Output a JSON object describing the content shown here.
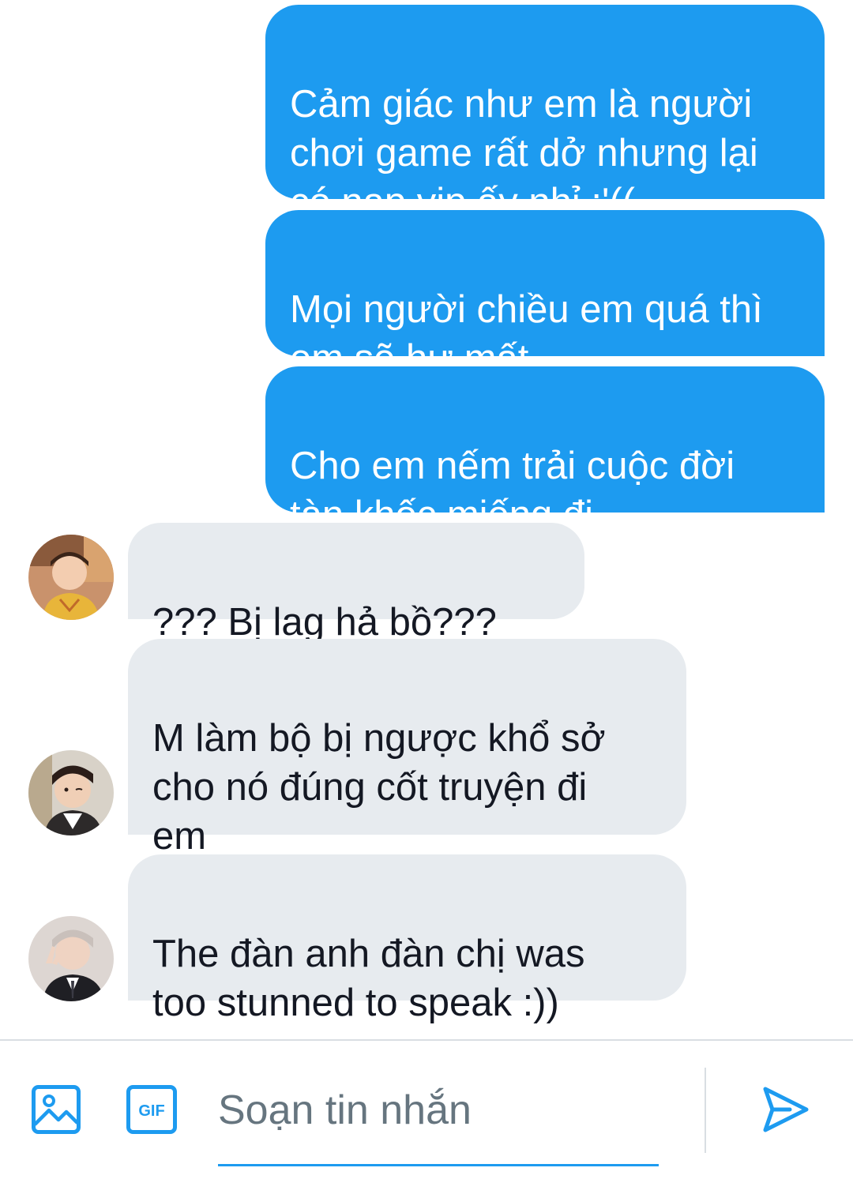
{
  "messages": {
    "outgoing": [
      "Cảm giác như em là người\nchơi game rất dở nhưng lại\ncó nạp vip ấy nhỉ :'((",
      "Mọi người chiều em quá thì\nem sẽ hư mất",
      "Cho em nếm trải cuộc đời\ntàn khốc miếng đi"
    ],
    "incoming": [
      {
        "text": "??? Bị lag hả bồ???",
        "emoji": "grinning-face-emoji"
      },
      {
        "text": "M làm bộ bị ngược khổ sở\ncho nó đúng cốt truyện đi\nem",
        "emoji": "eye-roll-face-emoji"
      },
      {
        "text": "The đàn anh đàn chị was\ntoo stunned to speak :))",
        "emoji": ""
      }
    ]
  },
  "composer": {
    "placeholder": "Soạn tin nhắn",
    "gif_label": "GIF",
    "icons": [
      "image-icon",
      "gif-icon",
      "send-icon"
    ]
  },
  "colors": {
    "outgoing_bubble": "#1d9bf0",
    "incoming_bubble": "#e7ebef",
    "accent": "#1d9bf0",
    "placeholder_text": "#66757f"
  }
}
